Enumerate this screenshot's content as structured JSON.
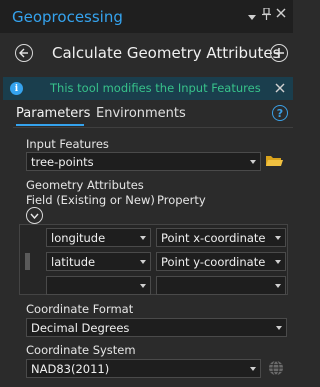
{
  "pane": {
    "title": "Geoprocessing",
    "menu_icon": "dropdown-icon",
    "pin_icon": "pin-icon",
    "close_icon": "close-icon"
  },
  "tool": {
    "title": "Calculate Geometry Attributes",
    "back_icon": "back-arrow-icon",
    "add_icon": "plus-icon"
  },
  "info": {
    "icon": "info-icon",
    "text": "This tool modifies the Input Features"
  },
  "tabs": [
    {
      "label": "Parameters",
      "active": true
    },
    {
      "label": "Environments",
      "active": false
    }
  ],
  "help_icon_text": "?",
  "params": {
    "input_features": {
      "label": "Input Features",
      "value": "tree-points"
    },
    "geometry": {
      "label": "Geometry Attributes",
      "col_field": "Field (Existing or New)",
      "col_property": "Property",
      "rows": [
        {
          "field": "longitude",
          "property": "Point x-coordinate"
        },
        {
          "field": "latitude",
          "property": "Point y-coordinate"
        },
        {
          "field": "",
          "property": ""
        }
      ]
    },
    "coordinate_format": {
      "label": "Coordinate Format",
      "value": "Decimal Degrees"
    },
    "coordinate_system": {
      "label": "Coordinate System",
      "value": "NAD83(2011)"
    }
  },
  "colors": {
    "accent": "#35a3ee",
    "info_text": "#37c28a",
    "folder": "#e6b325"
  }
}
